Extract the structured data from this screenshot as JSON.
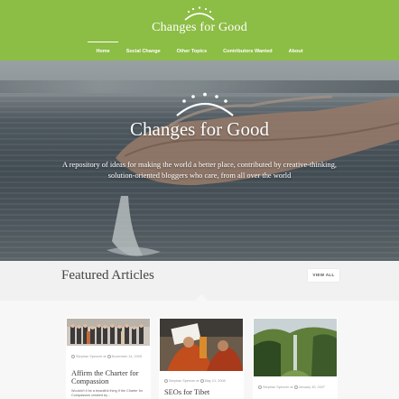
{
  "site": {
    "logo_text": "Changes for Good"
  },
  "nav": [
    {
      "label": "Home"
    },
    {
      "label": "Social Change"
    },
    {
      "label": "Other Topics"
    },
    {
      "label": "Contributors Wanted"
    },
    {
      "label": "About"
    }
  ],
  "hero": {
    "title": "Changes for Good",
    "subtitle": "A repository of ideas for making the world a better place, contributed by creative-thinking, solution-oriented bloggers who care, from all over the world"
  },
  "featured": {
    "title": "Featured Articles",
    "view_all": "VIEW ALL"
  },
  "cards": [
    {
      "author_meta": "Stephan Spencer at",
      "date_meta": "November 14, 2009",
      "title": "Affirm the Charter for Compassion",
      "excerpt": "Wouldn't it be a beautiful thing if the Charter for Compassion created by..."
    },
    {
      "author_meta": "Stephan Spencer at",
      "date_meta": "May 21, 2008",
      "title": "SEOs for Tibet",
      "excerpt": ""
    },
    {
      "author_meta": "Stephan Spencer at",
      "date_meta": "January 30, 2007",
      "title": "",
      "excerpt": ""
    }
  ],
  "colors": {
    "header_green": "#8cbd45",
    "page_bg": "#f1f1f1"
  },
  "icons": {
    "logo": "sun-arc-icon",
    "author": "person-icon",
    "date": "clock-icon"
  }
}
